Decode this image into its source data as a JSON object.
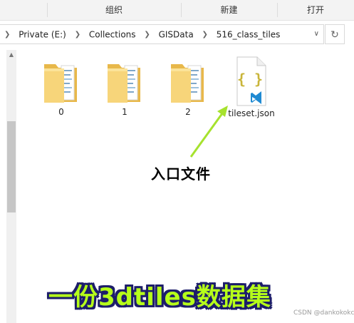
{
  "ribbon": {
    "tabs": [
      "组织",
      "新建",
      "打开"
    ]
  },
  "address_bar": {
    "crumbs": [
      "Private (E:)",
      "Collections",
      "GISData",
      "516_class_tiles"
    ],
    "dropdown_icon": "chevron-down-icon",
    "refresh_icon": "refresh-icon"
  },
  "files": [
    {
      "name": "0",
      "type": "folder"
    },
    {
      "name": "1",
      "type": "folder"
    },
    {
      "name": "2",
      "type": "folder"
    },
    {
      "name": "tileset.json",
      "type": "json",
      "glyph": "{ }"
    }
  ],
  "annotation": {
    "label": "入口文件",
    "arrow_color": "#a6e22e"
  },
  "banner": {
    "text": "一份3dtiles数据集",
    "fill_color": "#b6ff1a",
    "outline_color": "#1d1d6a"
  },
  "watermark": "CSDN @dankokokc"
}
